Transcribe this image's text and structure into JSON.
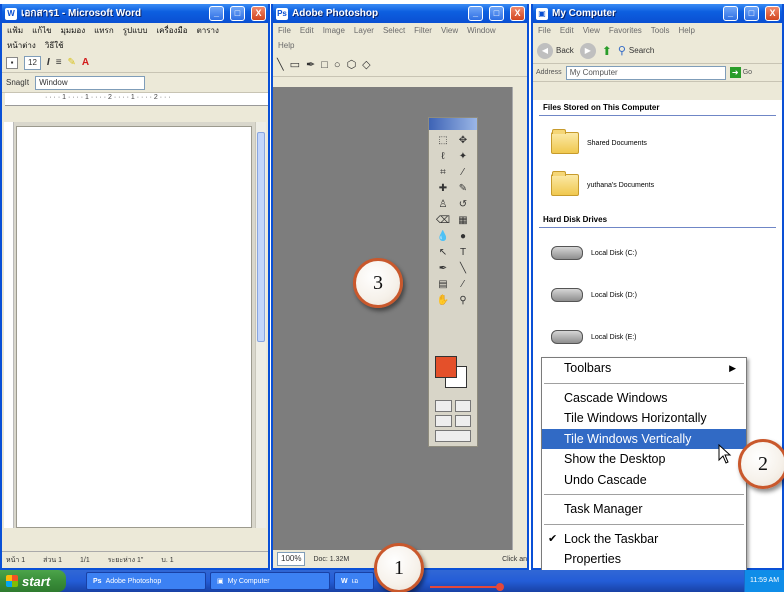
{
  "word": {
    "title": "เอกสาร1 - Microsoft Word",
    "menu1": [
      "แฟ้ม",
      "แก้ไข",
      "มุมมอง",
      "แทรก",
      "รูปแบบ",
      "เครื่องมือ",
      "ตาราง"
    ],
    "menu2": [
      "หน้าต่าง",
      "วิธีใช้"
    ],
    "font_size": "12",
    "snagit": "SnagIt",
    "window_label": "Window",
    "status": [
      "หน้า 1",
      "ส่วน 1",
      "1/1",
      "ระยะห่าง 1\"",
      "บ. 1"
    ]
  },
  "photoshop": {
    "title": "Adobe Photoshop",
    "menu1": [
      "File",
      "Edit",
      "Image",
      "Layer",
      "Select",
      "Filter",
      "View",
      "Window"
    ],
    "menu2": [
      "Help"
    ],
    "zoom": "100%",
    "doc": "Doc: 1.32M",
    "status_right": "Click an"
  },
  "mycomputer": {
    "title": "My Computer",
    "menu": [
      "File",
      "Edit",
      "View",
      "Favorites",
      "Tools",
      "Help"
    ],
    "back": "Back",
    "search": "Search",
    "address_label": "Address",
    "address": "My Computer",
    "go": "Go",
    "section_files": "Files Stored on This Computer",
    "shared": "Shared Documents",
    "user_docs": "yuthana's Documents",
    "section_disks": "Hard Disk Drives",
    "disk_c": "Local Disk (C:)",
    "disk_d": "Local Disk (D:)",
    "disk_e": "Local Disk (E:)"
  },
  "context_menu": {
    "toolbars": "Toolbars",
    "cascade": "Cascade Windows",
    "tile_h": "Tile Windows Horizontally",
    "tile_v": "Tile Windows Vertically",
    "show_desktop": "Show the Desktop",
    "undo": "Undo Cascade",
    "task_manager": "Task Manager",
    "lock": "Lock the Taskbar",
    "properties": "Properties"
  },
  "taskbar": {
    "start": "start",
    "task_ps": "Adobe Photoshop",
    "task_mc": "My Computer",
    "task_word": "เอ",
    "clock": "11:59 AM"
  },
  "callouts": {
    "one": "1",
    "two": "2",
    "three": "3"
  },
  "colors": {
    "xp_title": "#0a4fd2",
    "highlight": "#316ac5",
    "ps_foreground": "#e4502a",
    "callout_ring": "#c9582c"
  }
}
